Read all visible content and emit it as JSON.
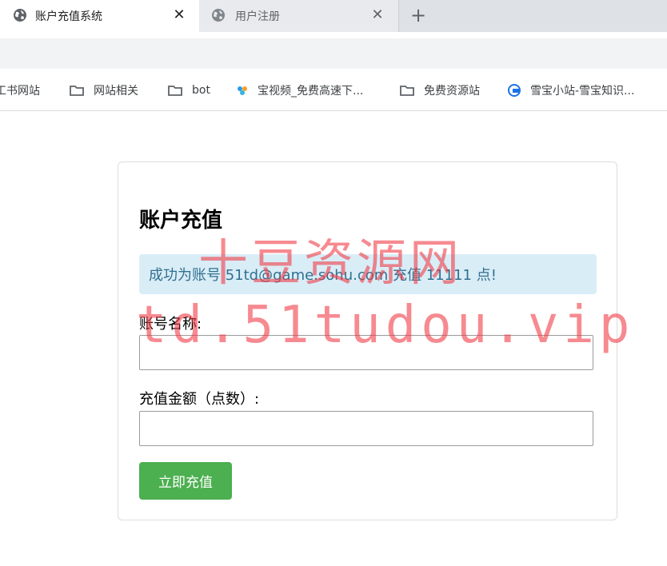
{
  "tabs": [
    {
      "title": "账户充值系统",
      "active": true,
      "close": "✕"
    },
    {
      "title": "用户注册",
      "active": false,
      "close": "✕"
    }
  ],
  "new_tab": "+",
  "bookmarks": [
    {
      "label": "工书网站",
      "icon": "none"
    },
    {
      "label": "网站相关",
      "icon": "folder-icon"
    },
    {
      "label": "bot",
      "icon": "folder-icon"
    },
    {
      "label": "宝视频_免费高速下...",
      "icon": "site-icon"
    },
    {
      "label": "免费资源站",
      "icon": "folder-icon"
    },
    {
      "label": "雪宝小站-雪宝知识...",
      "icon": "site-icon"
    }
  ],
  "form": {
    "title": "账户充值",
    "alert": "成功为账号 51td@game.sohu.com 充值 11111 点!",
    "account_label": "账号名称:",
    "account_value": "",
    "amount_label": "充值金额（点数）:",
    "amount_value": "",
    "submit_label": "立即充值"
  },
  "watermark": {
    "line1": "十豆资源网",
    "line2": "td.51tudou.vip"
  },
  "colors": {
    "alert_bg": "#d9edf7",
    "alert_text": "#31708f",
    "button": "#4caf50",
    "watermark": "#f03c46"
  }
}
